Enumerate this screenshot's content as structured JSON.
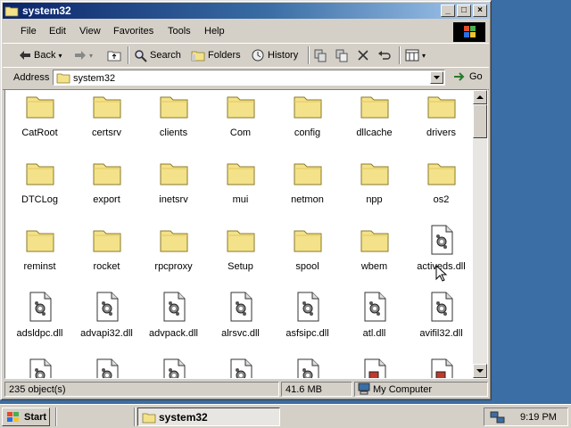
{
  "window": {
    "title": "system32",
    "controls": {
      "minimize": "_",
      "maximize": "□",
      "close": "×"
    }
  },
  "menu": [
    "File",
    "Edit",
    "View",
    "Favorites",
    "Tools",
    "Help"
  ],
  "toolbar": {
    "back": "Back",
    "search": "Search",
    "folders": "Folders",
    "history": "History"
  },
  "address": {
    "label": "Address",
    "value": "system32",
    "go": "Go"
  },
  "items": [
    {
      "name": "CatRoot",
      "type": "folder"
    },
    {
      "name": "certsrv",
      "type": "folder"
    },
    {
      "name": "clients",
      "type": "folder"
    },
    {
      "name": "Com",
      "type": "folder"
    },
    {
      "name": "config",
      "type": "folder"
    },
    {
      "name": "dllcache",
      "type": "folder"
    },
    {
      "name": "drivers",
      "type": "folder"
    },
    {
      "name": "DTCLog",
      "type": "folder"
    },
    {
      "name": "export",
      "type": "folder"
    },
    {
      "name": "inetsrv",
      "type": "folder"
    },
    {
      "name": "mui",
      "type": "folder"
    },
    {
      "name": "netmon",
      "type": "folder"
    },
    {
      "name": "npp",
      "type": "folder"
    },
    {
      "name": "os2",
      "type": "folder"
    },
    {
      "name": "reminst",
      "type": "folder"
    },
    {
      "name": "rocket",
      "type": "folder"
    },
    {
      "name": "rpcproxy",
      "type": "folder"
    },
    {
      "name": "Setup",
      "type": "folder"
    },
    {
      "name": "spool",
      "type": "folder"
    },
    {
      "name": "wbem",
      "type": "folder"
    },
    {
      "name": "activeds.dll",
      "type": "dll"
    },
    {
      "name": "adsldpc.dll",
      "type": "dll"
    },
    {
      "name": "advapi32.dll",
      "type": "dll"
    },
    {
      "name": "advpack.dll",
      "type": "dll"
    },
    {
      "name": "alrsvc.dll",
      "type": "dll"
    },
    {
      "name": "asfsipc.dll",
      "type": "dll"
    },
    {
      "name": "atl.dll",
      "type": "dll"
    },
    {
      "name": "avifil32.dll",
      "type": "dll"
    },
    {
      "name": "",
      "type": "dll"
    },
    {
      "name": "",
      "type": "dll"
    },
    {
      "name": "",
      "type": "dll"
    },
    {
      "name": "",
      "type": "dll"
    },
    {
      "name": "",
      "type": "dll"
    },
    {
      "name": "",
      "type": "exe"
    },
    {
      "name": "",
      "type": "exe"
    }
  ],
  "status": {
    "objects": "235 object(s)",
    "size": "41.6 MB",
    "zone": "My Computer"
  },
  "taskbar": {
    "start": "Start",
    "task": "system32",
    "clock": "9:19 PM"
  },
  "colors": {
    "desktop": "#3a6ea5",
    "titlebar": "#0a246a",
    "folder": "#f4e28a"
  }
}
